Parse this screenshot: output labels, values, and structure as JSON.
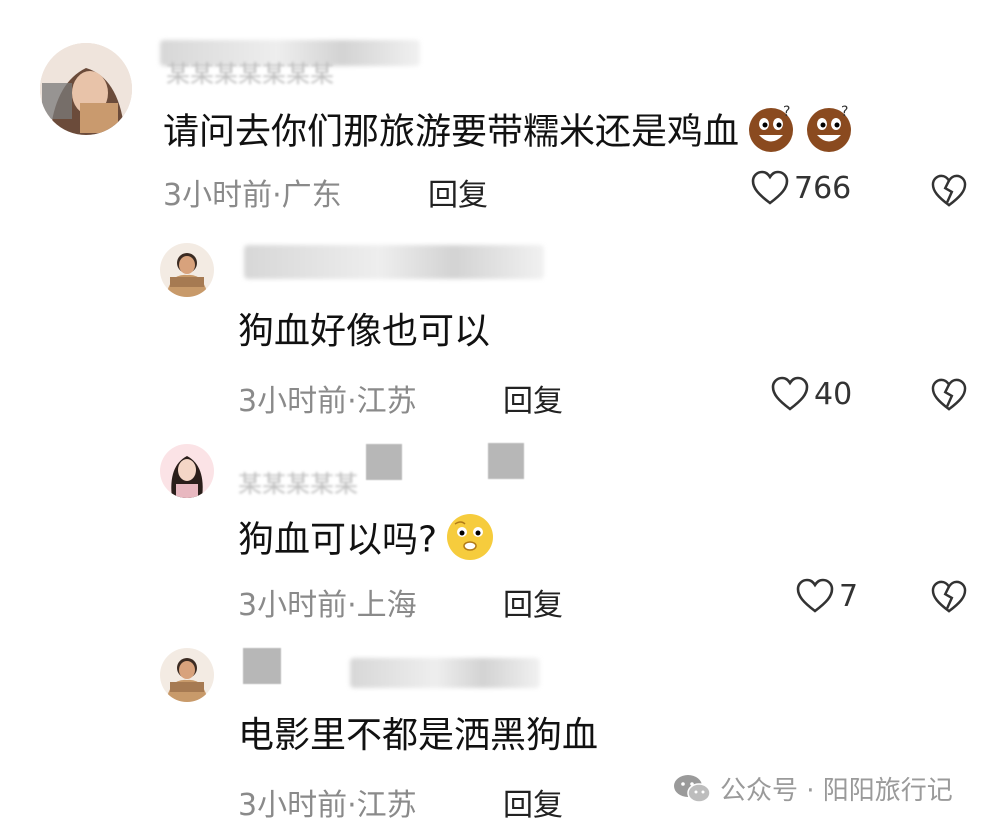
{
  "comments": [
    {
      "text": "请问去你们那旅游要带糯米还是鸡血",
      "time_location": "3小时前·广东",
      "reply_label": "回复",
      "likes": "766",
      "emoji_count": 2
    },
    {
      "text": "狗血好像也可以",
      "time_location": "3小时前·江苏",
      "reply_label": "回复",
      "likes": "40"
    },
    {
      "text": "狗血可以吗?",
      "time_location": "3小时前·上海",
      "reply_label": "回复",
      "likes": "7"
    },
    {
      "text": "电影里不都是洒黑狗血",
      "time_location": "3小时前·江苏",
      "reply_label": "回复"
    }
  ],
  "watermark": {
    "text": "公众号 · 阳阳旅行记"
  },
  "icons": {
    "like": "heart-outline-icon",
    "dislike": "broken-heart-icon",
    "wechat": "wechat-icon"
  }
}
